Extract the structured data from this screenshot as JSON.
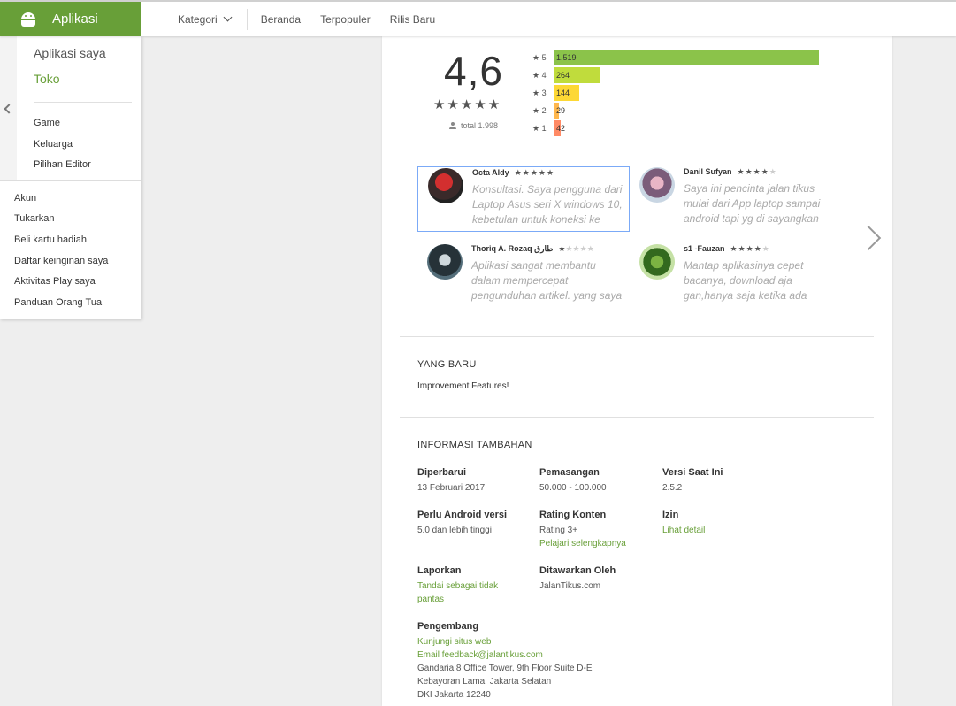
{
  "colors": {
    "brand": "#689f38",
    "bar5": "#8bc34a",
    "bar4": "#c0dc3c",
    "bar3": "#fdd835",
    "bar2": "#ffb74d",
    "bar1": "#ff8a65"
  },
  "header": {
    "app_name": "Aplikasi",
    "nav": [
      "Kategori",
      "Beranda",
      "Terpopuler",
      "Rilis Baru"
    ]
  },
  "sidebar": {
    "main_items": [
      "Aplikasi saya",
      "Toko"
    ],
    "sub_items": [
      "Game",
      "Keluarga",
      "Pilihan Editor"
    ],
    "account_items": [
      "Akun",
      "Tukarkan",
      "Beli kartu hadiah",
      "Daftar keinginan saya",
      "Aktivitas Play saya",
      "Panduan Orang Tua"
    ]
  },
  "rating": {
    "average": "4,6",
    "total_label": "total 1.998",
    "histogram": [
      {
        "star": "5",
        "count": "1.519",
        "fraction": 1.0
      },
      {
        "star": "4",
        "count": "264",
        "fraction": 0.174
      },
      {
        "star": "3",
        "count": "144",
        "fraction": 0.095
      },
      {
        "star": "2",
        "count": "29",
        "fraction": 0.019
      },
      {
        "star": "1",
        "count": "42",
        "fraction": 0.028
      }
    ]
  },
  "reviews": [
    {
      "name": "Octa Aldy",
      "stars": 5,
      "text": "Konsultasi. Saya pengguna dari Laptop Asus seri X windows 10, kebetulan untuk koneksi ke"
    },
    {
      "name": "Danil Sufyan",
      "stars": 4,
      "text": "Saya ini pencinta jalan tikus mulai dari App laptop sampai android tapi yg di sayangkan"
    },
    {
      "name": "Thoriq A. Rozaq طارق",
      "stars": 1,
      "text": "Aplikasi sangat membantu dalam mempercepat pengunduhan artikel. yang saya"
    },
    {
      "name": "s1 -Fauzan",
      "stars": 4,
      "text": "Mantap aplikasinya cepet bacanya, download aja gan,hanya saja ketika ada"
    }
  ],
  "whats_new": {
    "title": "YANG BARU",
    "text": "Improvement Features!"
  },
  "additional_info": {
    "title": "INFORMASI TAMBAHAN",
    "updated_label": "Diperbarui",
    "updated_value": "13 Februari 2017",
    "installs_label": "Pemasangan",
    "installs_value": "50.000 - 100.000",
    "version_label": "Versi Saat Ini",
    "version_value": "2.5.2",
    "android_label": "Perlu Android versi",
    "android_value": "5.0 dan lebih tinggi",
    "content_rating_label": "Rating Konten",
    "content_rating_value": "Rating 3+",
    "content_rating_link": "Pelajari selengkapnya",
    "permissions_label": "Izin",
    "permissions_link": "Lihat detail",
    "report_label": "Laporkan",
    "report_link_1": "Tandai sebagai tidak",
    "report_link_2": "pantas",
    "offered_by_label": "Ditawarkan Oleh",
    "offered_by_value": "JalanTikus.com",
    "developer_label": "Pengembang",
    "developer_website": "Kunjungi situs web",
    "developer_email": "Email feedback@jalantikus.com",
    "developer_address_1": "Gandaria 8 Office Tower, 9th Floor Suite D-E",
    "developer_address_2": "Kebayoran Lama, Jakarta Selatan",
    "developer_address_3": "DKI Jakarta 12240"
  }
}
